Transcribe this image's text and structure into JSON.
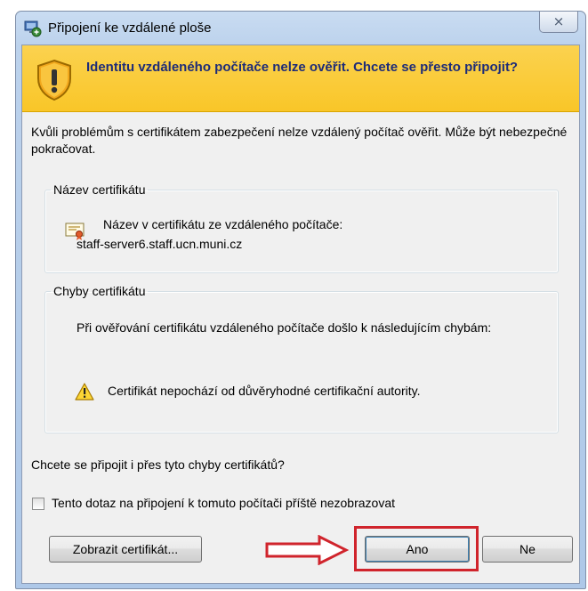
{
  "window": {
    "title": "Připojení ke vzdálené ploše",
    "close_symbol": "⨯"
  },
  "banner": {
    "icon": "shield-warning-icon",
    "text": "Identitu vzdáleného počítače nelze ověřit. Chcete se přesto připojit?"
  },
  "intro": "Kvůli problémům s certifikátem zabezpečení nelze vzdálený počítač ověřit. Může být nebezpečné pokračovat.",
  "cert_name_group": {
    "legend": "Název certifikátu",
    "icon": "certificate-icon",
    "label": "Název v certifikátu ze vzdáleného počítače:",
    "value": "staff-server6.staff.ucn.muni.cz"
  },
  "cert_errors_group": {
    "legend": "Chyby certifikátu",
    "description": "Při ověřování certifikátu vzdáleného počítače došlo k následujícím chybám:",
    "icon": "warning-icon",
    "error": "Certifikát nepochází od důvěryhodné certifikační autority."
  },
  "question": "Chcete se připojit i přes tyto chyby certifikátů?",
  "dont_ask": {
    "label": "Tento dotaz na připojení k tomuto počítači příště nezobrazovat",
    "checked": false
  },
  "buttons": {
    "show_cert": "Zobrazit certifikát...",
    "yes": "Ano",
    "no": "Ne"
  },
  "colors": {
    "banner": "#f9c628",
    "banner_text": "#1e2c78",
    "highlight": "#d0242c",
    "arrow": "#d0242c"
  }
}
